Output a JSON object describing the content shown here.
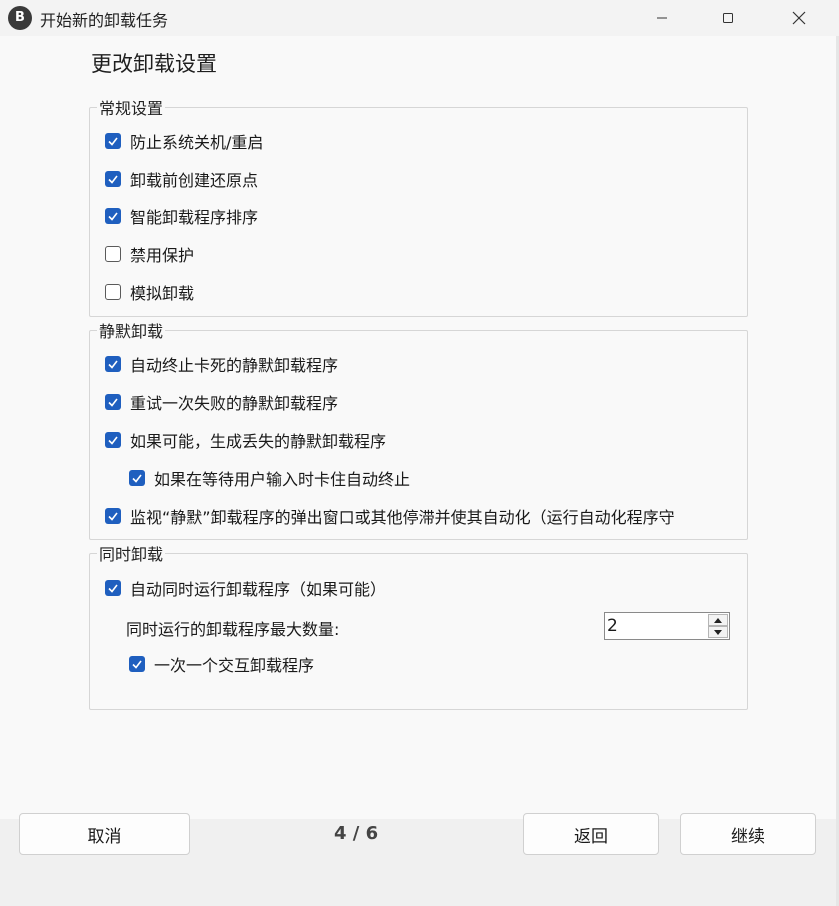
{
  "window": {
    "title": "开始新的卸载任务",
    "app_icon_glyph": "B",
    "minimize_icon": "minimize-icon",
    "maximize_icon": "maximize-icon",
    "close_icon": "close-icon"
  },
  "page_title": "更改卸载设置",
  "groups": {
    "general": {
      "legend": "常规设置",
      "items": [
        {
          "label": "防止系统关机/重启",
          "checked": true
        },
        {
          "label": "卸载前创建还原点",
          "checked": true
        },
        {
          "label": "智能卸载程序排序",
          "checked": true
        },
        {
          "label": "禁用保护",
          "checked": false
        },
        {
          "label": "模拟卸载",
          "checked": false
        }
      ]
    },
    "quiet": {
      "legend": "静默卸载",
      "items": [
        {
          "label": "自动终止卡死的静默卸载程序",
          "checked": true
        },
        {
          "label": "重试一次失败的静默卸载程序",
          "checked": true
        },
        {
          "label": "如果可能，生成丢失的静默卸载程序",
          "checked": true
        },
        {
          "label": "如果在等待用户输入时卡住自动终止",
          "checked": true
        },
        {
          "label": "监视“静默”卸载程序的弹出窗口或其他停滞并使其自动化（运行自动化程序守",
          "checked": true
        }
      ]
    },
    "concurrent": {
      "legend": "同时卸载",
      "items": [
        {
          "label": "自动同时运行卸载程序（如果可能）",
          "checked": true
        },
        {
          "label": "一次一个交互卸载程序",
          "checked": true
        }
      ],
      "max_label": "同时运行的卸载程序最大数量:",
      "max_value": "2"
    }
  },
  "footer": {
    "cancel_label": "取消",
    "page_indicator": "4 / 6",
    "back_label": "返回",
    "next_label": "继续"
  },
  "colors": {
    "checkbox_on": "#1f5fbf",
    "background": "#f9f9f9"
  }
}
